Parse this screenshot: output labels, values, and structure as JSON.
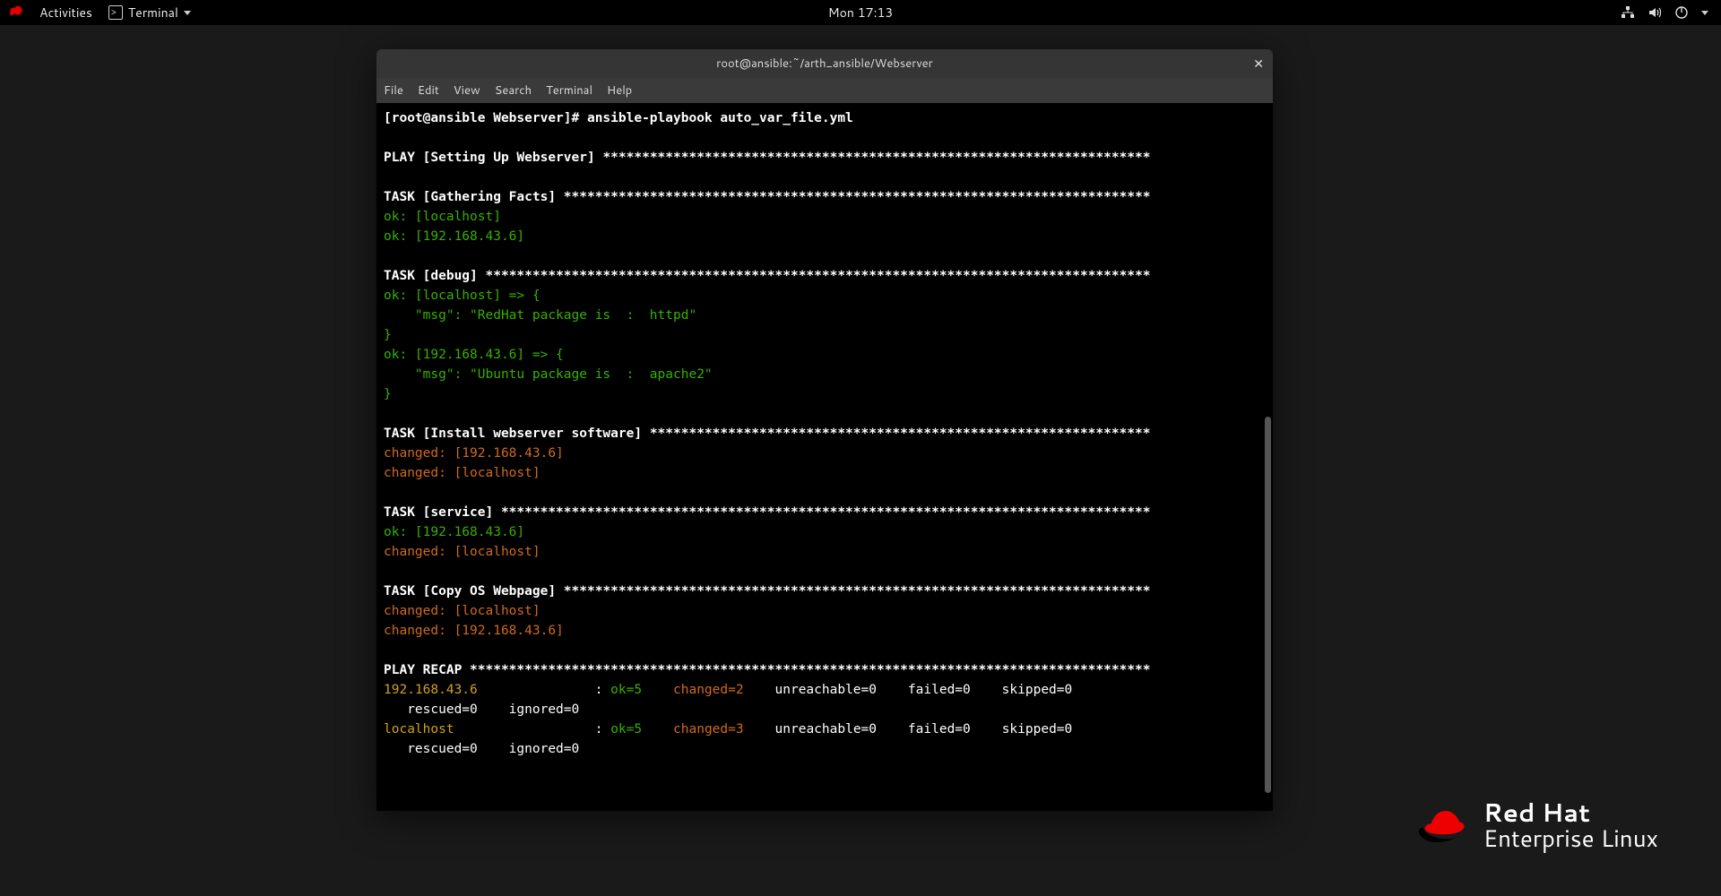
{
  "topbar": {
    "activities": "Activities",
    "terminal": "Terminal",
    "clock": "Mon 17:13"
  },
  "window": {
    "title": "root@ansible:~/arth_ansible/Webserver"
  },
  "menu": {
    "file": "File",
    "edit": "Edit",
    "view": "View",
    "search": "Search",
    "terminal": "Terminal",
    "help": "Help"
  },
  "term": {
    "prompt": "[root@ansible Webserver]# ansible-playbook auto_var_file.yml",
    "play_header": "PLAY [Setting Up Webserver] ",
    "play_stars": "**********************************************************************",
    "task_facts": "TASK [Gathering Facts] ",
    "task_facts_stars": "***************************************************************************",
    "ok_localhost": "ok: [localhost]",
    "ok_ip": "ok: [192.168.43.6]",
    "task_debug": "TASK [debug] ",
    "task_debug_stars": "*************************************************************************************",
    "debug_local_open": "ok: [localhost] => {",
    "debug_local_msg": "    \"msg\": \"RedHat package is  :  httpd\"",
    "debug_close": "}",
    "debug_ip_open": "ok: [192.168.43.6] => {",
    "debug_ip_msg": "    \"msg\": \"Ubuntu package is  :  apache2\"",
    "task_install": "TASK [Install webserver software] ",
    "task_install_stars": "****************************************************************",
    "changed_ip": "changed: [192.168.43.6]",
    "changed_local": "changed: [localhost]",
    "task_service": "TASK [service] ",
    "task_service_stars": "***********************************************************************************",
    "task_copy": "TASK [Copy OS Webpage] ",
    "task_copy_stars": "***************************************************************************",
    "recap": "PLAY RECAP ",
    "recap_stars": "***************************************************************************************",
    "recap1_host": "192.168.43.6",
    "recap1_sep": "               : ",
    "recap1_ok": "ok=5",
    "recap1_sp1": "    ",
    "recap1_changed": "changed=2",
    "recap1_rest": "    unreachable=0    failed=0    skipped=0",
    "recap1_line2": "   rescued=0    ignored=0",
    "recap2_host": "localhost",
    "recap2_sep": "                  : ",
    "recap2_ok": "ok=5",
    "recap2_changed": "changed=3",
    "recap2_rest": "    unreachable=0    failed=0    skipped=0",
    "recap2_line2": "   rescued=0    ignored=0"
  },
  "brand": {
    "top": "Red Hat",
    "bottom": "Enterprise Linux"
  }
}
